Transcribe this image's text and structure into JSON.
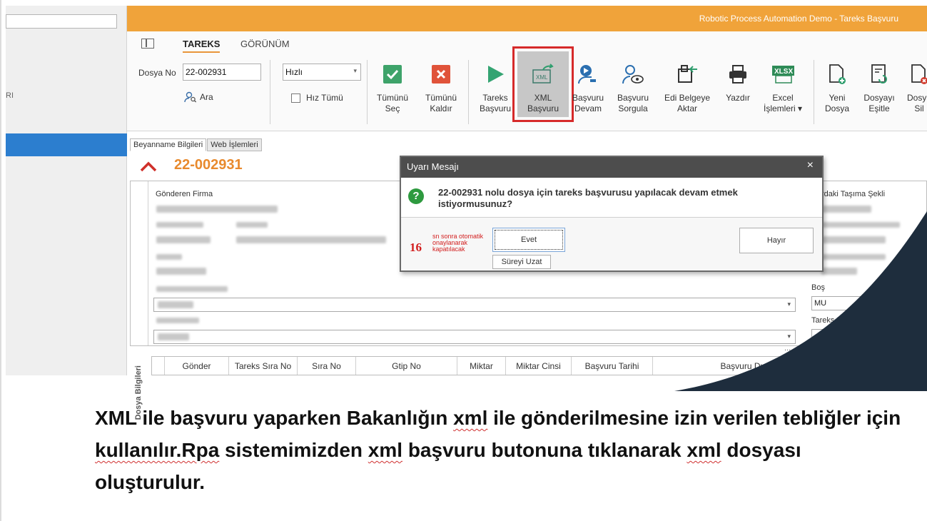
{
  "window": {
    "title": "Robotic Process Automation Demo - Tareks Başvuru"
  },
  "left_pane": {
    "label": "RI"
  },
  "ribbon": {
    "tabs": [
      {
        "label": "TAREKS"
      },
      {
        "label": "GÖRÜNÜM"
      }
    ],
    "dosya_no_label": "Dosya No",
    "dosya_no_value": "22-002931",
    "search_label": "Ara",
    "speed_value": "Hızlı",
    "hiz_tumu_label": "Hız Tümü",
    "buttons": [
      {
        "line1": "Tümünü",
        "line2": "Seç",
        "icon": "check-icon"
      },
      {
        "line1": "Tümünü",
        "line2": "Kaldır",
        "icon": "remove-icon"
      },
      {
        "line1": "Tareks",
        "line2": "Başvuru",
        "icon": "play-icon"
      },
      {
        "line1": "XML",
        "line2": "Başvuru",
        "icon": "xml-export-icon"
      },
      {
        "line1": "Başvuru",
        "line2": "Devam",
        "icon": "user-play-icon"
      },
      {
        "line1": "Başvuru",
        "line2": "Sorgula",
        "icon": "user-search-icon"
      },
      {
        "line1": "Edi Belgeye",
        "line2": "Aktar",
        "icon": "edi-transfer-icon"
      },
      {
        "line1": "Yazdır",
        "line2": "",
        "icon": "printer-icon"
      },
      {
        "line1": "Excel",
        "line2": "İşlemleri ▾",
        "icon": "xlsx-icon"
      },
      {
        "line1": "Yeni",
        "line2": "Dosya",
        "icon": "new-file-icon"
      },
      {
        "line1": "Dosyayı",
        "line2": "Eşitle",
        "icon": "sync-file-icon"
      },
      {
        "line1": "Dosya",
        "line2": "Sil",
        "icon": "delete-file-icon"
      }
    ]
  },
  "document": {
    "tabs": [
      {
        "label": "Beyanname Bilgileri"
      },
      {
        "label": "Web İşlemleri"
      }
    ],
    "dosya_title": "22-002931",
    "section_title": "Dosya Bilgileri",
    "fields": {
      "gonderen_firma": "Gönderen Firma",
      "tasima_sekli": "rdaki Taşıma Şekli",
      "bos": "Boş",
      "mu_value": "MU",
      "tareks_ba": "Tareks Ba"
    },
    "more_dots": "..."
  },
  "grid": {
    "columns": [
      "Gönder",
      "Tareks Sıra No",
      "Sıra No",
      "Gtip No",
      "Miktar",
      "Miktar Cinsi",
      "Başvuru Tarihi",
      "Başvuru Durumu"
    ]
  },
  "dialog": {
    "title": "Uyarı Mesajı",
    "close": "×",
    "icon": "?",
    "message": "22-002931 nolu dosya için tareks başvurusu yapılacak devam etmek istiyormusunuz?",
    "countdown": "16",
    "auto_text": "sn sonra otomatik onaylanarak kapatılacak",
    "yes": "Evet",
    "extend": "Süreyi Uzat",
    "no": "Hayır"
  },
  "caption": {
    "p1": "XML ile başvuru yaparken Bakanlığın ",
    "w1": "xml",
    "p2": " ile gönderilmesine izin verilen tebliğler için ",
    "w2": "kullanılır.Rpa",
    "p3": " sistemimizden ",
    "w3": "xml",
    "p4": " başvuru butonuna tıklanarak ",
    "w4": "xml",
    "p5": " dosyası oluşturulur."
  },
  "colors": {
    "accent": "#f0a33a",
    "highlight": "#d62a2a",
    "selection": "#2c7ecf",
    "curve": "#1e2d3d"
  }
}
